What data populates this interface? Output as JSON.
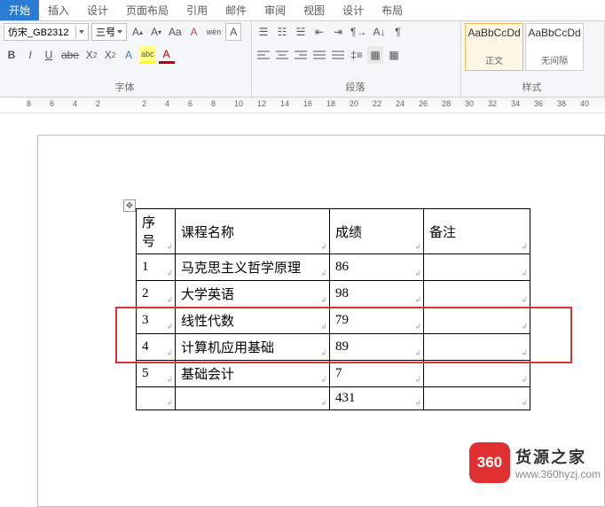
{
  "tabs": {
    "start": "开始",
    "insert": "插入",
    "design": "设计",
    "layout": "页面布局",
    "ref": "引用",
    "mail": "邮件",
    "review": "审阅",
    "view": "视图",
    "tt_design": "设计",
    "tt_layout": "布局"
  },
  "font": {
    "group_label": "字体",
    "name": "仿宋_GB2312",
    "size": "三号",
    "bold": "B",
    "italic": "I",
    "underline": "U",
    "strike": "abe",
    "sub": "X",
    "sup": "X",
    "clear": "A",
    "grow": "A",
    "shrink": "A",
    "case": "Aa",
    "phonetic": "wèn",
    "charbox": "A",
    "fontcolor": "A",
    "highlight": "abc",
    "textfx": "A"
  },
  "para": {
    "group_label": "段落",
    "bul": "•",
    "num": "1",
    "ml": "a",
    "outdent": "⇤",
    "indent": "⇥",
    "sort": "A↓",
    "show": "¶",
    "al": "≡",
    "ac": "≡",
    "ar": "≡",
    "aj": "≡",
    "dist": "≡",
    "lsp": "‡",
    "shade": "▦",
    "border": "▦"
  },
  "styles": {
    "group_label": "样式",
    "preview": "AaBbCcDd",
    "normal": "正文",
    "nospace": "无间隔"
  },
  "chart_data": {
    "type": "table",
    "headers": [
      "序号",
      "课程名称",
      "成绩",
      "备注"
    ],
    "rows": [
      {
        "seq": "1",
        "name": "马克思主义哲学原理",
        "score": "86",
        "note": ""
      },
      {
        "seq": "2",
        "name": "大学英语",
        "score": "98",
        "note": ""
      },
      {
        "seq": "3",
        "name": "线性代数",
        "score": "79",
        "note": ""
      },
      {
        "seq": "4",
        "name": "计算机应用基础",
        "score": "89",
        "note": ""
      },
      {
        "seq": "5",
        "name": "基础会计",
        "score": "7",
        "note": ""
      }
    ],
    "total_row": {
      "seq": "",
      "name": "",
      "score": "431",
      "note": ""
    },
    "selected_rows": [
      2,
      3
    ]
  },
  "ruler": [
    "8",
    "6",
    "4",
    "2",
    "",
    "2",
    "4",
    "6",
    "8",
    "10",
    "12",
    "14",
    "16",
    "18",
    "20",
    "22",
    "24",
    "26",
    "28",
    "30",
    "32",
    "34",
    "36",
    "38",
    "40"
  ],
  "watermark": {
    "badge": "360",
    "cn": "货源之家",
    "url": "www.360hyzj.com"
  }
}
